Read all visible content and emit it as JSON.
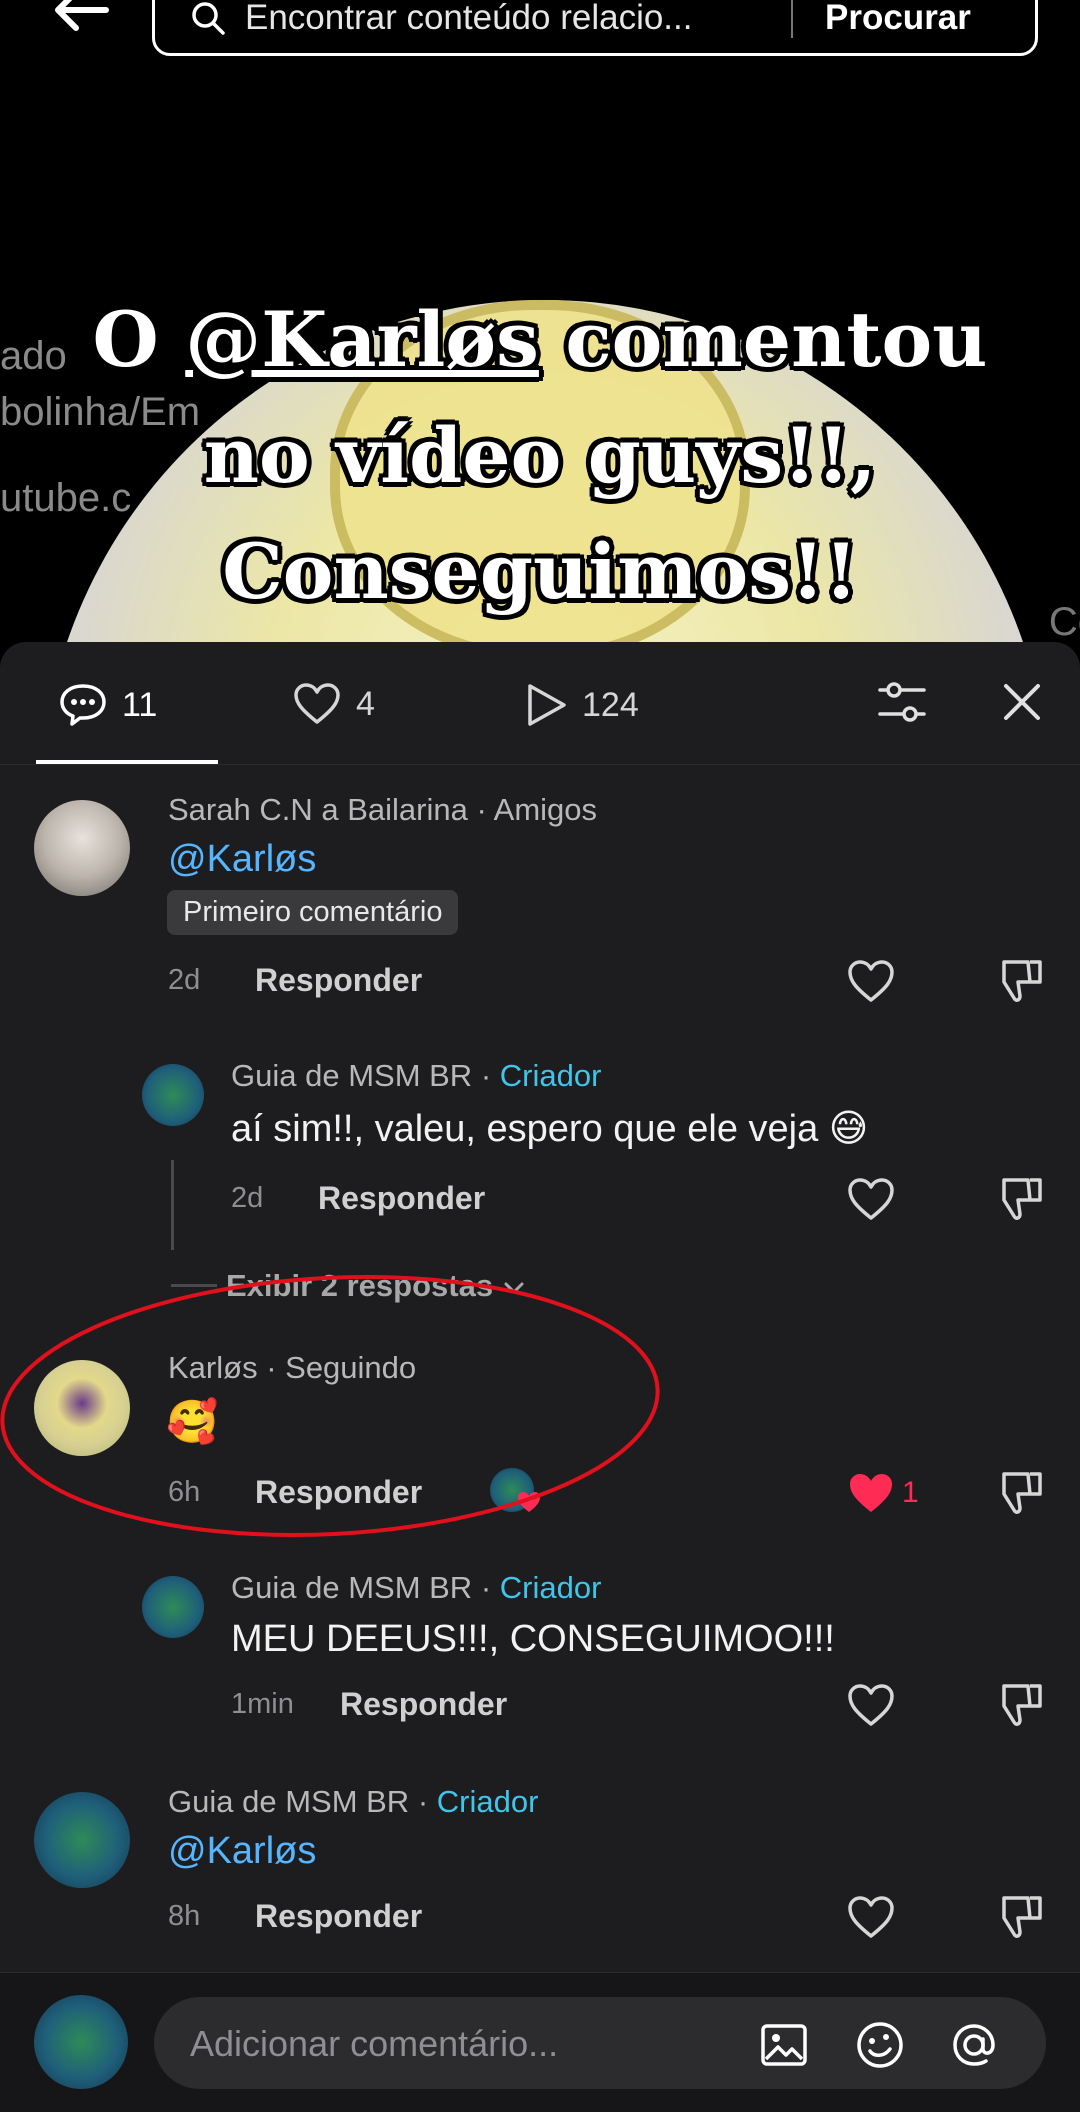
{
  "search": {
    "placeholder": "Encontrar conteúdo relacio...",
    "button_label": "Procurar"
  },
  "background_fragments": [
    "ado",
    "bolinha/Em",
    "utube.c",
    "Co"
  ],
  "caption": {
    "prefix": "O ",
    "mention": "@Karløs",
    "suffix": " comentou",
    "line2": "no vídeo guys!!,",
    "line3": "Conseguimos!!"
  },
  "tabs": {
    "comments": "11",
    "likes": "4",
    "views": "124"
  },
  "comments": [
    {
      "author": "Sarah C.N a Bailarina",
      "sep": " · ",
      "relation": "Amigos",
      "mention": "@Karløs",
      "badge": "Primeiro comentário",
      "time": "2d",
      "reply_label": "Responder",
      "reply": {
        "author": "Guia de MSM BR",
        "sep": " · ",
        "role": "Criador",
        "text": "aí sim!!, valeu, espero que ele veja 😅",
        "time": "2d",
        "reply_label": "Responder"
      },
      "view_replies": "Exibir 2 respostas"
    },
    {
      "author": "Karløs",
      "sep": " · ",
      "relation": "Seguindo",
      "text": "🥰",
      "time": "6h",
      "reply_label": "Responder",
      "like_count": "1",
      "reply": {
        "author": "Guia de MSM BR",
        "sep": " · ",
        "role": "Criador",
        "text": "MEU DEEUS!!!, CONSEGUIMOO!!!",
        "time": "1min",
        "reply_label": "Responder"
      }
    },
    {
      "author": "Guia de MSM BR",
      "sep": " · ",
      "role": "Criador",
      "mention": "@Karløs",
      "time": "8h",
      "reply_label": "Responder"
    }
  ],
  "composer": {
    "placeholder": "Adicionar comentário..."
  },
  "colors": {
    "sheet_bg": "#1d1d1f",
    "mention": "#56b5ff",
    "creator": "#3fc4ea",
    "liked": "#fe2c55",
    "annotation": "#e0101c"
  },
  "icons": [
    "back-arrow-icon",
    "search-icon",
    "comment-icon",
    "heart-icon",
    "play-icon",
    "filter-icon",
    "close-icon",
    "dislike-icon",
    "image-icon",
    "emoji-icon",
    "at-icon"
  ]
}
